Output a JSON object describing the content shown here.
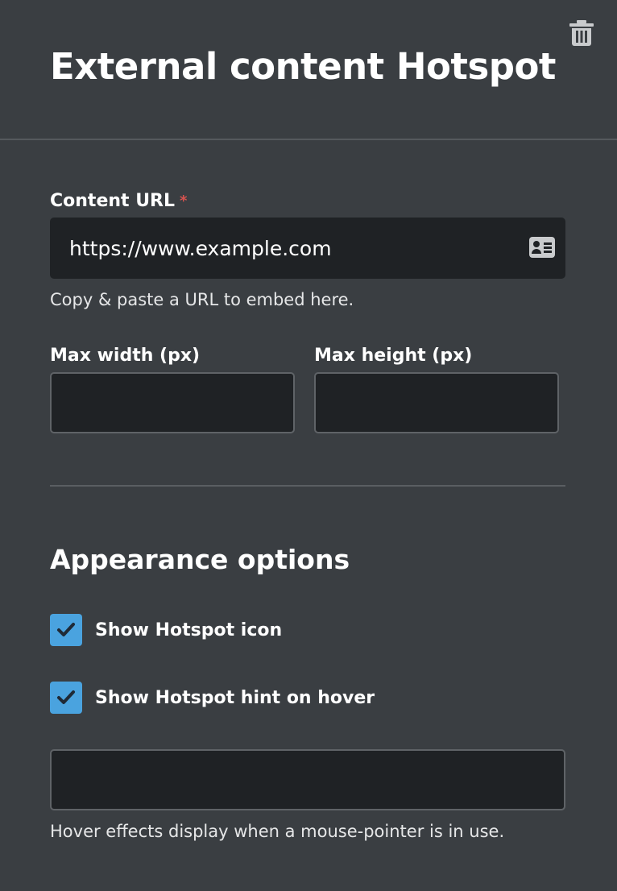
{
  "header": {
    "title": "External content Hotspot",
    "delete_icon": "trash-icon"
  },
  "content_url": {
    "label": "Content URL",
    "required_marker": "*",
    "value": "https://www.example.com",
    "icon": "contact-card-icon",
    "helper": "Copy & paste a URL to embed here."
  },
  "dimensions": {
    "max_width_label": "Max width (px)",
    "max_width_value": "",
    "max_height_label": "Max height (px)",
    "max_height_value": ""
  },
  "appearance": {
    "title": "Appearance options",
    "show_icon": {
      "label": "Show Hotspot icon",
      "checked": true
    },
    "show_hint": {
      "label": "Show Hotspot hint on hover",
      "checked": true
    },
    "hint_value": "",
    "helper": "Hover effects display when a mouse-pointer is in use."
  },
  "colors": {
    "background": "#3a3e42",
    "input_background": "#1f2225",
    "checkbox": "#4aa3df",
    "required": "#d9534f"
  }
}
